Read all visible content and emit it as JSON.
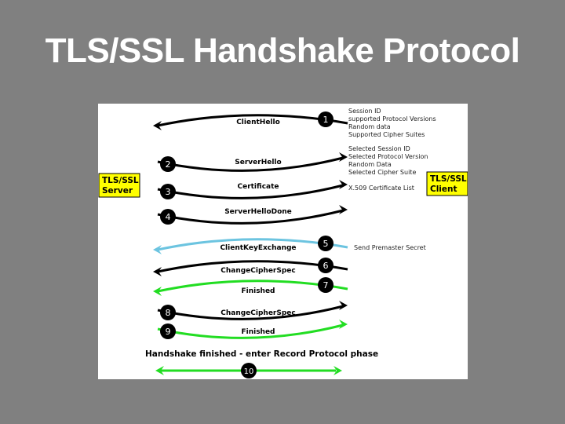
{
  "slide_title": "TLS/SSL Handshake Protocol",
  "server_label": [
    "TLS/SSL",
    "Server"
  ],
  "client_label": [
    "TLS/SSL",
    "Client"
  ],
  "colors": {
    "background": "#808080",
    "panel": "#ffffff",
    "label_box": "#ffff00",
    "black_arrow": "#000000",
    "blue_arrow": "#6cc4e0",
    "green_arrow": "#22dd22"
  },
  "messages": [
    {
      "step": "1",
      "label": "ClientHello",
      "direction": "left",
      "color": "black",
      "notes": [
        "Session ID",
        "supported Protocol Versions",
        "Random data",
        "Supported Cipher Suites"
      ]
    },
    {
      "step": "2",
      "label": "ServerHello",
      "direction": "right",
      "color": "black",
      "notes": [
        "Selected Session ID",
        "Selected Protocol Version",
        "Random Data",
        "Selected Cipher Suite"
      ]
    },
    {
      "step": "3",
      "label": "Certificate",
      "direction": "right",
      "color": "black",
      "notes": [
        "X.509 Certificate List"
      ]
    },
    {
      "step": "4",
      "label": "ServerHelloDone",
      "direction": "right",
      "color": "black",
      "notes": []
    },
    {
      "step": "5",
      "label": "ClientKeyExchange",
      "direction": "left",
      "color": "blue",
      "notes": [
        "Send Premaster Secret"
      ]
    },
    {
      "step": "6",
      "label": "ChangeCipherSpec",
      "direction": "left",
      "color": "black",
      "notes": []
    },
    {
      "step": "7",
      "label": "Finished",
      "direction": "left",
      "color": "green",
      "notes": []
    },
    {
      "step": "8",
      "label": "ChangeCipherSpec",
      "direction": "right",
      "color": "black",
      "notes": []
    },
    {
      "step": "9",
      "label": "Finished",
      "direction": "right",
      "color": "green",
      "notes": []
    }
  ],
  "record_phase": {
    "label": "Handshake finished - enter Record Protocol phase",
    "step": "10",
    "color": "green"
  }
}
